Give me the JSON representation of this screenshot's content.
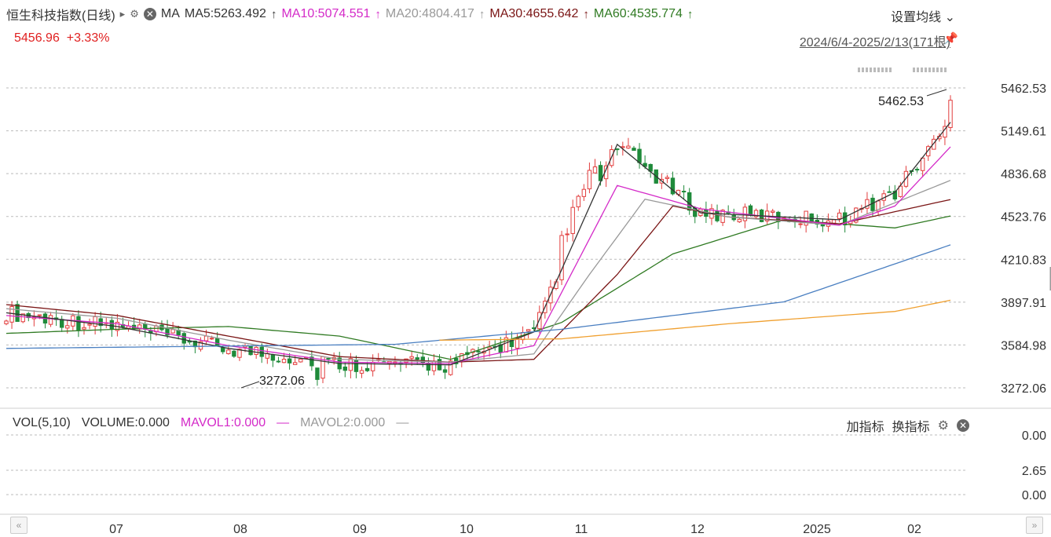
{
  "header": {
    "title": "恒生科技指数(日线)",
    "indicator": "MA",
    "ma5": "MA5:5263.492",
    "ma10": "MA10:5074.551",
    "ma20": "MA20:4804.417",
    "ma30": "MA30:4655.642",
    "ma60": "MA60:4535.774",
    "arrow": "↑",
    "settings_label": "设置均线",
    "last_price": "5456.96",
    "change_pct": "+3.33%",
    "date_range": "2024/6/4-2025/2/13(171根)"
  },
  "volume_panel": {
    "label": "VOL(5,10)",
    "volume": "VOLUME:0.000",
    "mavol1": "MAVOL1:0.000",
    "mavol2": "MAVOL2:0.000",
    "dash": "—",
    "add_indicator": "加指标",
    "switch_indicator": "换指标",
    "ticks": [
      "0.00",
      "2.65",
      "0.00"
    ]
  },
  "chart_data": {
    "type": "candlestick",
    "title": "恒生科技指数(日线)",
    "y_ticks": [
      "5462.53",
      "5149.61",
      "4836.68",
      "4523.76",
      "4210.83",
      "3897.91",
      "3584.98",
      "3272.06"
    ],
    "ylim": [
      3272.06,
      5462.53
    ],
    "x_ticks": [
      "07",
      "08",
      "09",
      "10",
      "11",
      "12",
      "2025",
      "02"
    ],
    "annotations": {
      "high": "5462.53",
      "low": "3272.06"
    },
    "period": "2024/6/4-2025/2/13",
    "bars": 171,
    "colors": {
      "up": "#e23d3d",
      "down": "#1f8a3a",
      "ma5": "#333333",
      "ma10": "#d42ac8",
      "ma20": "#999999",
      "ma30": "#7a1515",
      "ma60": "#2f7a22",
      "ma120": "#4a7fc1",
      "ma250": "#f0a030"
    },
    "ma_key_points": {
      "ma5": [
        [
          0,
          3820
        ],
        [
          20,
          3720
        ],
        [
          40,
          3560
        ],
        [
          60,
          3450
        ],
        [
          80,
          3440
        ],
        [
          95,
          3680
        ],
        [
          110,
          5050
        ],
        [
          125,
          4550
        ],
        [
          150,
          4500
        ],
        [
          160,
          4700
        ],
        [
          171,
          5263
        ]
      ],
      "ma10": [
        [
          0,
          3800
        ],
        [
          20,
          3740
        ],
        [
          40,
          3580
        ],
        [
          60,
          3460
        ],
        [
          80,
          3450
        ],
        [
          95,
          3580
        ],
        [
          110,
          4750
        ],
        [
          125,
          4580
        ],
        [
          150,
          4460
        ],
        [
          160,
          4600
        ],
        [
          171,
          5075
        ]
      ],
      "ma20": [
        [
          0,
          3850
        ],
        [
          20,
          3780
        ],
        [
          40,
          3620
        ],
        [
          60,
          3480
        ],
        [
          80,
          3460
        ],
        [
          95,
          3520
        ],
        [
          105,
          4100
        ],
        [
          115,
          4650
        ],
        [
          130,
          4520
        ],
        [
          150,
          4460
        ],
        [
          171,
          4804
        ]
      ],
      "ma30": [
        [
          0,
          3880
        ],
        [
          20,
          3800
        ],
        [
          40,
          3650
        ],
        [
          60,
          3500
        ],
        [
          80,
          3460
        ],
        [
          95,
          3480
        ],
        [
          110,
          4100
        ],
        [
          120,
          4600
        ],
        [
          130,
          4520
        ],
        [
          150,
          4470
        ],
        [
          171,
          4656
        ]
      ],
      "ma60": [
        [
          0,
          3670
        ],
        [
          20,
          3700
        ],
        [
          40,
          3720
        ],
        [
          60,
          3650
        ],
        [
          80,
          3480
        ],
        [
          100,
          3750
        ],
        [
          120,
          4250
        ],
        [
          140,
          4500
        ],
        [
          160,
          4440
        ],
        [
          171,
          4536
        ]
      ]
    }
  }
}
